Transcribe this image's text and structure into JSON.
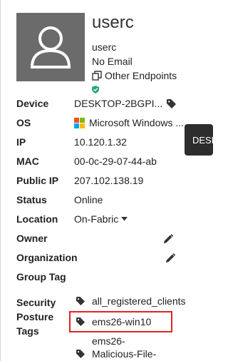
{
  "user": {
    "name": "userc",
    "username": "userc",
    "email": "No Email",
    "endpoints_link": "Other Endpoints"
  },
  "fields": {
    "device": {
      "label": "Device",
      "value": "DESKTOP-2BGPI..."
    },
    "os": {
      "label": "OS",
      "value": "Microsoft Windows ..."
    },
    "ip": {
      "label": "IP",
      "value": "10.120.1.32"
    },
    "mac": {
      "label": "MAC",
      "value": "00-0c-29-07-44-ab"
    },
    "public_ip": {
      "label": "Public IP",
      "value": "207.102.138.19"
    },
    "status": {
      "label": "Status",
      "value": "Online"
    },
    "location": {
      "label": "Location",
      "value": "On-Fabric"
    },
    "owner": {
      "label": "Owner"
    },
    "organization": {
      "label": "Organization"
    },
    "group_tag": {
      "label": "Group Tag"
    }
  },
  "tooltip": {
    "text": "DESKT"
  },
  "security_posture": {
    "label_line1": "Security",
    "label_line2": "Posture",
    "label_line3": "Tags",
    "tags": [
      "all_registered_clients",
      "ems26-win10",
      "ems26-",
      "Malicious-File-"
    ]
  },
  "colors": {
    "avatar_bg": "#6b6b6b",
    "badge_green": "#2aa876",
    "highlight": "#e02424"
  }
}
